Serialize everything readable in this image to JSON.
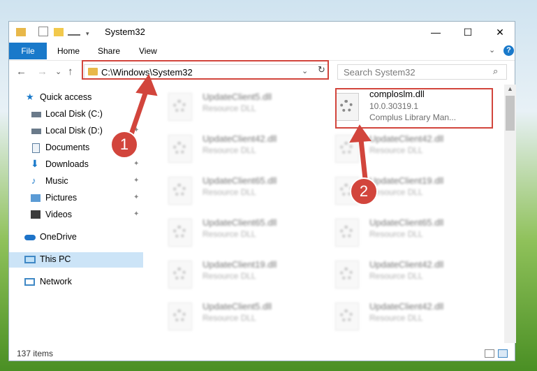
{
  "window": {
    "title": "System32",
    "minimize": "—",
    "maximize": "☐",
    "close": "✕"
  },
  "ribbon": {
    "file": "File",
    "tabs": [
      "Home",
      "Share",
      "View"
    ],
    "help": "?",
    "expand": "⌄"
  },
  "nav": {
    "back": "←",
    "forward": "→",
    "recent": "⌄",
    "up": "↑",
    "address": "C:\\Windows\\System32",
    "address_dropdown": "⌄",
    "refresh": "↻",
    "search_placeholder": "Search System32",
    "search_icon": "⌕"
  },
  "sidebar": {
    "items": [
      {
        "label": "Quick access",
        "icon": "star-icon"
      },
      {
        "label": "Local Disk (C:)",
        "icon": "drive-icon"
      },
      {
        "label": "Local Disk (D:)",
        "icon": "drive-icon"
      },
      {
        "label": "Documents",
        "icon": "documents-icon"
      },
      {
        "label": "Downloads",
        "icon": "download-icon"
      },
      {
        "label": "Music",
        "icon": "music-icon"
      },
      {
        "label": "Pictures",
        "icon": "pictures-icon"
      },
      {
        "label": "Videos",
        "icon": "videos-icon"
      },
      {
        "label": "OneDrive",
        "icon": "cloud-icon"
      },
      {
        "label": "This PC",
        "icon": "computer-icon"
      },
      {
        "label": "Network",
        "icon": "network-icon"
      }
    ],
    "pin": "📌"
  },
  "files": {
    "left": [
      {
        "name": "UpdateClient5.dll",
        "type": "Resource DLL"
      },
      {
        "name": "UpdateClient42.dll",
        "type": "Resource DLL"
      },
      {
        "name": "UpdateClient65.dll",
        "type": "Resource DLL"
      },
      {
        "name": "UpdateClient65.dll",
        "type": "Resource DLL"
      },
      {
        "name": "UpdateClient19.dll",
        "type": "Resource DLL"
      },
      {
        "name": "UpdateClient5.dll",
        "type": "Resource DLL"
      }
    ],
    "right_highlight": {
      "name": "comploslm.dll",
      "version": "10.0.30319.1",
      "description": "Complus Library Man..."
    },
    "right": [
      {
        "name": "UpdateClient42.dll",
        "type": "Resource DLL"
      },
      {
        "name": "UpdateClient19.dll",
        "type": "Resource DLL"
      },
      {
        "name": "UpdateClient65.dll",
        "type": "Resource DLL"
      },
      {
        "name": "UpdateClient42.dll",
        "type": "Resource DLL"
      },
      {
        "name": "UpdateClient42.dll",
        "type": "Resource DLL"
      }
    ]
  },
  "status": {
    "count": "137 items"
  },
  "annotations": {
    "badge1": "1",
    "badge2": "2",
    "color": "#d2453c"
  }
}
